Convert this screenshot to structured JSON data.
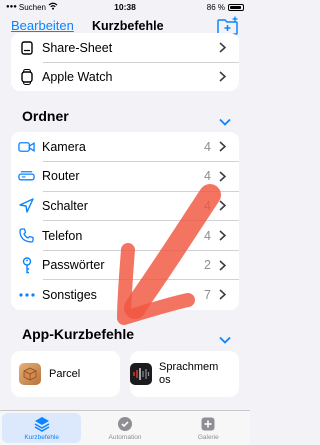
{
  "status_bar": {
    "carrier": "Suchen",
    "time": "10:38",
    "battery": "86 %",
    "battery_level": 0.86
  },
  "nav": {
    "edit_label": "Bearbeiten",
    "title": "Kurzbefehle",
    "add_icon": "folder-plus-icon"
  },
  "top_items": [
    {
      "label": "Share-Sheet",
      "icon": "share-sheet-icon"
    },
    {
      "label": "Apple Watch",
      "icon": "watch-icon"
    }
  ],
  "folders": {
    "header": "Ordner",
    "items": [
      {
        "label": "Kamera",
        "count": "4",
        "icon": "camera-icon"
      },
      {
        "label": "Router",
        "count": "4",
        "icon": "router-icon"
      },
      {
        "label": "Schalter",
        "count": "4",
        "icon": "location-arrow-icon"
      },
      {
        "label": "Telefon",
        "count": "4",
        "icon": "phone-icon"
      },
      {
        "label": "Passwörter",
        "count": "2",
        "icon": "key-icon"
      },
      {
        "label": "Sonstiges",
        "count": "7",
        "icon": "ellipsis-icon"
      }
    ]
  },
  "app_shortcuts": {
    "header": "App-Kurzbefehle",
    "items": [
      {
        "label": "Parcel",
        "icon": "parcel-app-icon"
      },
      {
        "label_line1": "Sprachmem",
        "label_line2": "os",
        "icon": "voice-memos-app-icon"
      }
    ]
  },
  "tabs": [
    {
      "label": "Kurzbefehle",
      "icon": "layers-icon",
      "active": true
    },
    {
      "label": "Automation",
      "icon": "clock-check-icon",
      "active": false
    },
    {
      "label": "Galerie",
      "icon": "gallery-plus-icon",
      "active": false
    }
  ],
  "colors": {
    "accent": "#0a84ff",
    "background": "#f2f2f7",
    "annotation_arrow": "#f2553f"
  }
}
